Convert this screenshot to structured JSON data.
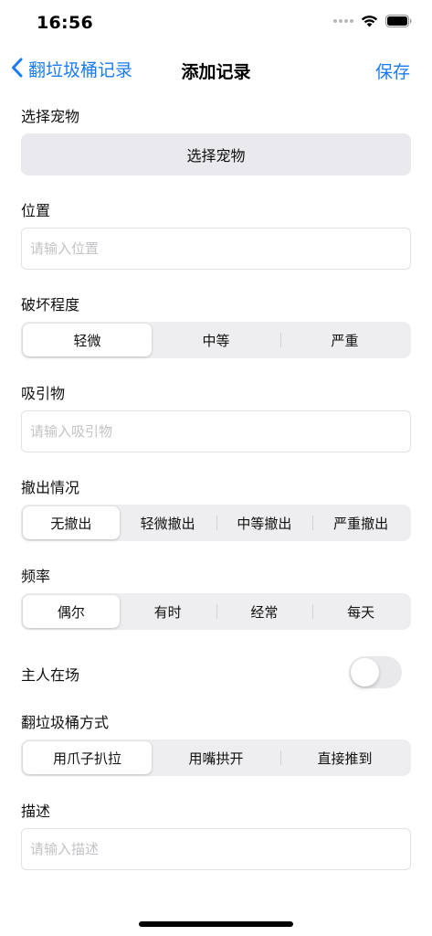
{
  "status_bar": {
    "time": "16:56"
  },
  "nav": {
    "back_label": "翻垃圾桶记录",
    "title": "添加记录",
    "save_label": "保存"
  },
  "form": {
    "pet": {
      "label": "选择宠物",
      "button_label": "选择宠物"
    },
    "location": {
      "label": "位置",
      "placeholder": "请输入位置",
      "value": ""
    },
    "damage": {
      "label": "破坏程度",
      "options": [
        "轻微",
        "中等",
        "严重"
      ],
      "selected": "轻微"
    },
    "attractant": {
      "label": "吸引物",
      "placeholder": "请输入吸引物",
      "value": ""
    },
    "withdrawal": {
      "label": "撤出情况",
      "options": [
        "无撤出",
        "轻微撤出",
        "中等撤出",
        "严重撤出"
      ],
      "selected": "无撤出"
    },
    "frequency": {
      "label": "频率",
      "options": [
        "偶尔",
        "有时",
        "经常",
        "每天"
      ],
      "selected": "偶尔"
    },
    "owner_present": {
      "label": "主人在场",
      "on": false
    },
    "method": {
      "label": "翻垃圾桶方式",
      "options": [
        "用爪子扒拉",
        "用嘴拱开",
        "直接推到"
      ],
      "selected": "用爪子扒拉"
    },
    "description": {
      "label": "描述",
      "placeholder": "请输入描述",
      "value": ""
    }
  },
  "colors": {
    "accent": "#1a7cf3",
    "segment_bg": "#eeeef0",
    "button_bg": "#e9e9ee"
  }
}
